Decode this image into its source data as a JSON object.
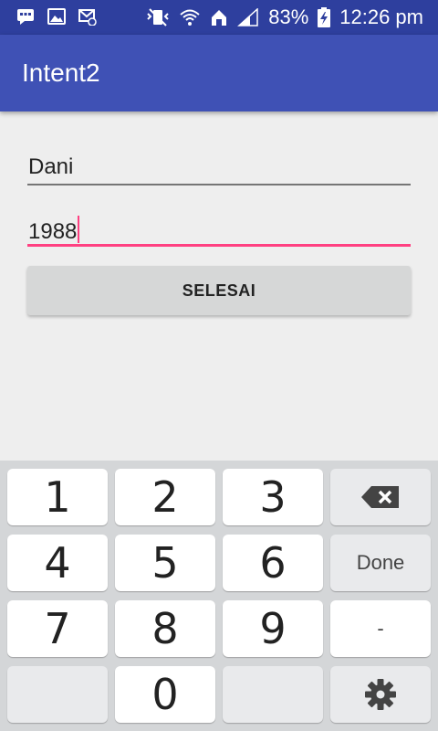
{
  "status_bar": {
    "battery": "83%",
    "time": "12:26 pm"
  },
  "app_bar": {
    "title": "Intent2"
  },
  "form": {
    "name_value": "Dani",
    "year_value": "1988",
    "submit_label": "SELESAI"
  },
  "keyboard": {
    "keys": {
      "k1": "1",
      "k2": "2",
      "k3": "3",
      "k4": "4",
      "k5": "5",
      "k6": "6",
      "k7": "7",
      "k8": "8",
      "k9": "9",
      "k0": "0"
    },
    "done_label": "Done",
    "minus_label": "-"
  },
  "colors": {
    "status_bar": "#2e3f9e",
    "app_bar": "#3f51b5",
    "accent": "#ff4081"
  }
}
